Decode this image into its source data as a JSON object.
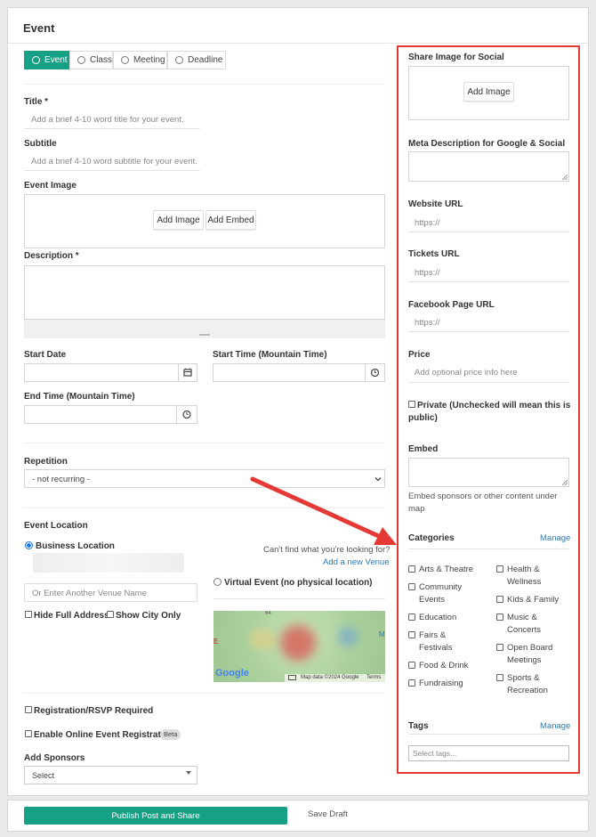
{
  "header": {
    "title": "Event"
  },
  "types": [
    {
      "label": "Event",
      "active": true
    },
    {
      "label": "Class"
    },
    {
      "label": "Meeting"
    },
    {
      "label": "Deadline"
    }
  ],
  "title": {
    "label": "Title *",
    "placeholder": "Add a brief 4-10 word title for your event."
  },
  "subtitle": {
    "label": "Subtitle",
    "placeholder": "Add a brief 4-10 word subtitle for your event."
  },
  "event_image": {
    "label": "Event Image",
    "add_image": "Add Image",
    "add_embed": "Add Embed"
  },
  "description": {
    "label": "Description *"
  },
  "start_date": {
    "label": "Start Date"
  },
  "start_time": {
    "label": "Start Time (Mountain Time)"
  },
  "end_time": {
    "label": "End Time (Mountain Time)"
  },
  "repetition": {
    "label": "Repetition",
    "value": "- not recurring -"
  },
  "location": {
    "label": "Event Location",
    "business": "Business Location",
    "cant_find": "Can't find what you're looking for?",
    "add_venue": "Add a new Venue",
    "venue_placeholder": "Or Enter Another Venue Name",
    "virtual": "Virtual Event (no physical location)",
    "hide_address": "Hide Full Addresss",
    "show_city": "Show City Only",
    "map": {
      "google": "Google",
      "map_data": "Map data ©2024 Google",
      "terms": "Terms",
      "letter_e": "E",
      "letter_m": "M",
      "marker": "64"
    }
  },
  "registration": {
    "rsvp": "Registration/RSVP Required",
    "online": "Enable Online Event Registration",
    "beta": "Beta"
  },
  "sponsors": {
    "label": "Add Sponsors",
    "value": "Select"
  },
  "sidebar": {
    "share_image": {
      "label": "Share Image for Social",
      "button": "Add Image"
    },
    "meta": {
      "label": "Meta Description for Google & Social"
    },
    "website": {
      "label": "Website URL",
      "placeholder": "https://"
    },
    "tickets": {
      "label": "Tickets URL",
      "placeholder": "https://"
    },
    "facebook": {
      "label": "Facebook Page URL",
      "placeholder": "https://"
    },
    "price": {
      "label": "Price",
      "placeholder": "Add optional price info here"
    },
    "private": {
      "line1": "Private (Unchecked will mean this is",
      "line2": "public)"
    },
    "embed": {
      "label": "Embed",
      "help1": "Embed sponsors or other content under",
      "help2": "map"
    },
    "categories": {
      "label": "Categories",
      "manage": "Manage",
      "left": [
        [
          "Arts & Theatre"
        ],
        [
          "Community",
          "Events"
        ],
        [
          "Education"
        ],
        [
          "Fairs &",
          "Festivals"
        ],
        [
          "Food & Drink"
        ],
        [
          "Fundraising"
        ]
      ],
      "right": [
        [
          "Health &",
          "Wellness"
        ],
        [
          "Kids & Family"
        ],
        [
          "Music &",
          "Concerts"
        ],
        [
          "Open Board",
          "Meetings"
        ],
        [
          "Sports &",
          "Recreation"
        ]
      ]
    },
    "tags": {
      "label": "Tags",
      "manage": "Manage",
      "placeholder": "Select tags..."
    }
  },
  "footer": {
    "publish": "Publish Post and Share",
    "save_draft": "Save Draft"
  },
  "colors": {
    "accent": "#16a085",
    "link": "#2a7ab8",
    "highlight": "#e53935"
  }
}
